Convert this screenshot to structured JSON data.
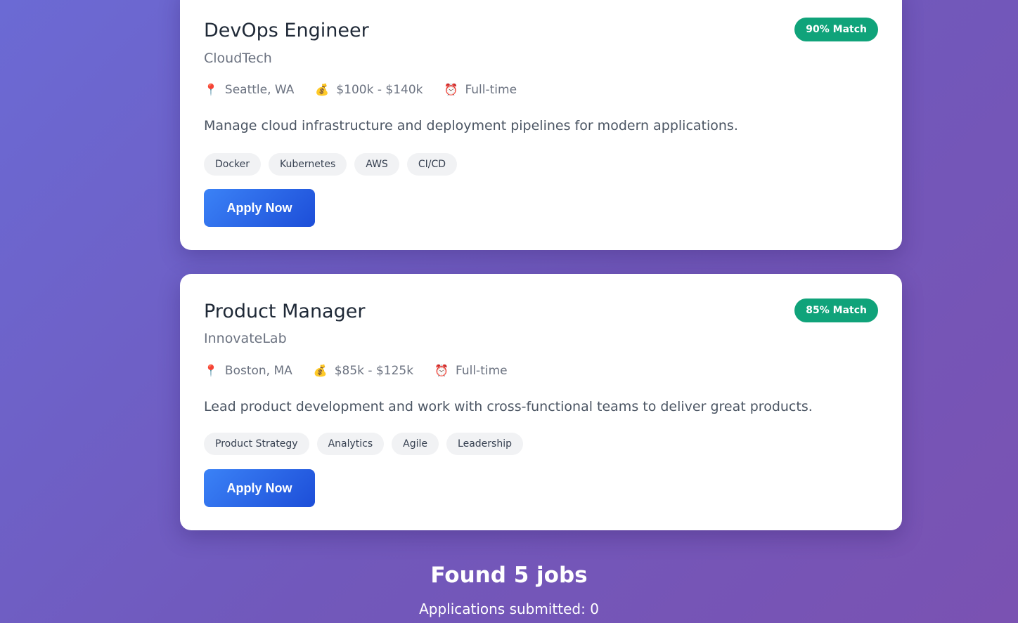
{
  "jobs": [
    {
      "title": "DevOps Engineer",
      "company": "CloudTech",
      "match": "90% Match",
      "location": "Seattle, WA",
      "salary": "$100k - $140k",
      "type": "Full-time",
      "description": "Manage cloud infrastructure and deployment pipelines for modern applications.",
      "tags": [
        "Docker",
        "Kubernetes",
        "AWS",
        "CI/CD"
      ],
      "apply_label": "Apply Now"
    },
    {
      "title": "Product Manager",
      "company": "InnovateLab",
      "match": "85% Match",
      "location": "Boston, MA",
      "salary": "$85k - $125k",
      "type": "Full-time",
      "description": "Lead product development and work with cross-functional teams to deliver great products.",
      "tags": [
        "Product Strategy",
        "Analytics",
        "Agile",
        "Leadership"
      ],
      "apply_label": "Apply Now"
    }
  ],
  "icons": {
    "location": "map-pin-icon",
    "salary": "money-bag-icon",
    "type": "alarm-clock-icon"
  },
  "colors": {
    "match_badge": "#10a37a",
    "apply_button": "#2563eb"
  },
  "summary": {
    "found": "Found 5 jobs",
    "applications": "Applications submitted: 0"
  }
}
